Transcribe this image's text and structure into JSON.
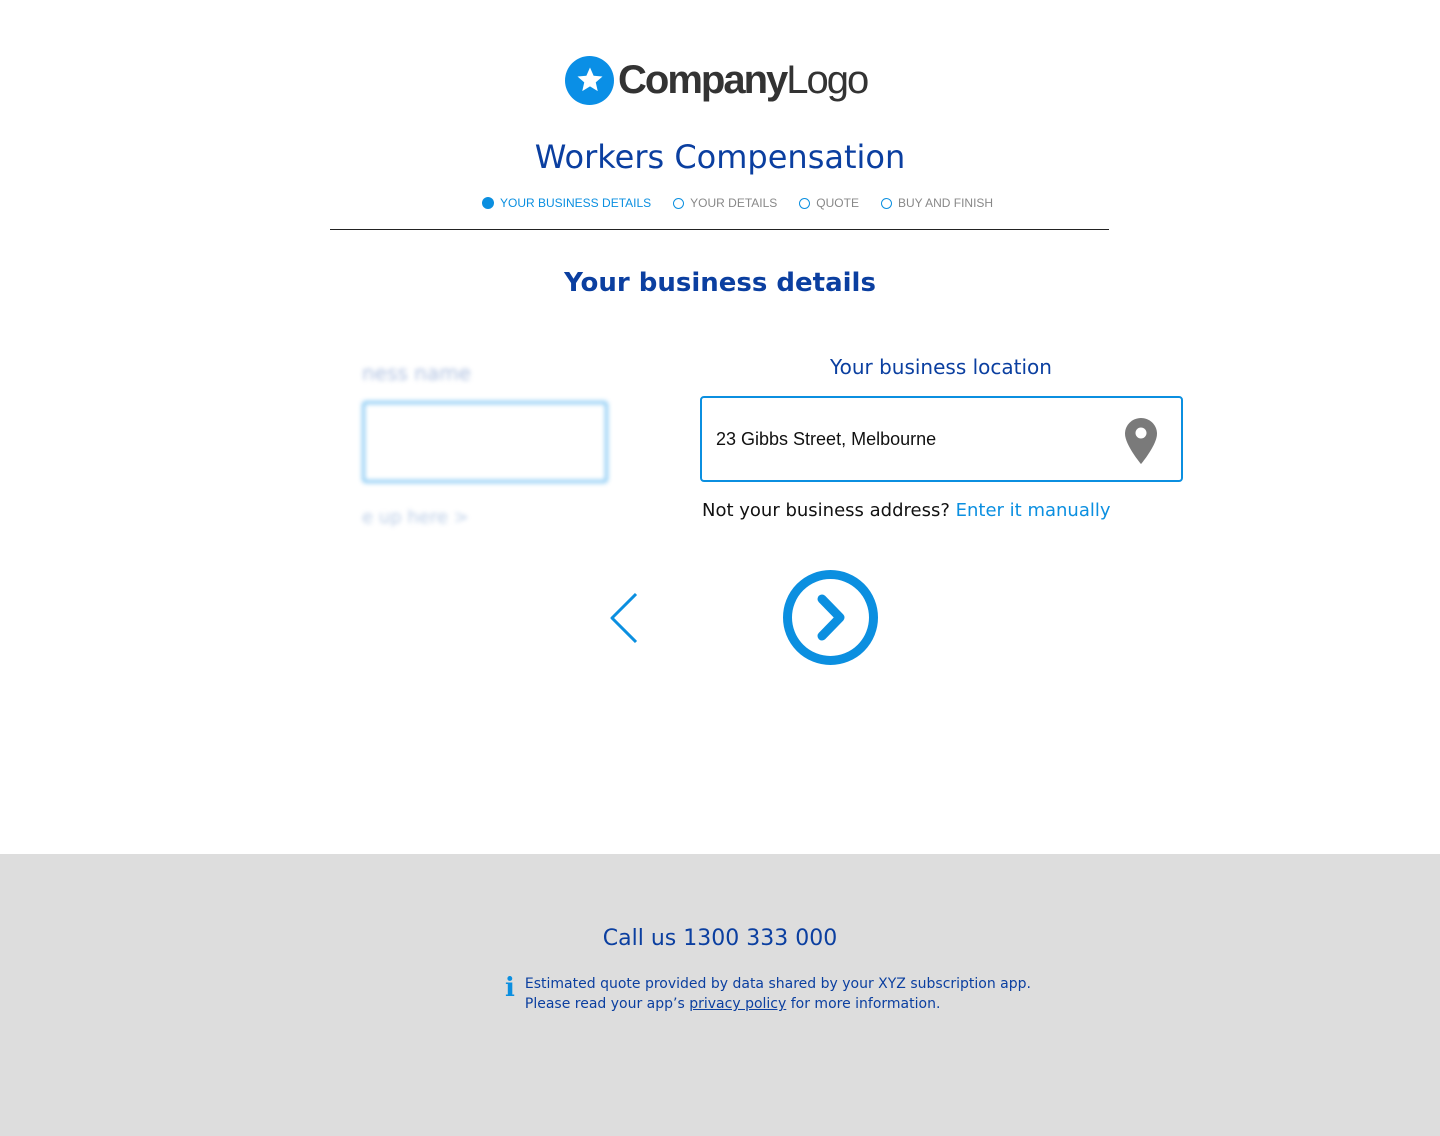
{
  "logo": {
    "text_bold": "Company",
    "text_regular": "Logo",
    "icon": "star-icon"
  },
  "title": "Workers Compensation",
  "steps": [
    {
      "label": "YOUR BUSINESS DETAILS",
      "active": true
    },
    {
      "label": "YOUR DETAILS",
      "active": false
    },
    {
      "label": "QUOTE",
      "active": false
    },
    {
      "label": "BUY AND FINISH",
      "active": false
    }
  ],
  "section_title": "Your business details",
  "blurred_panel": {
    "label": "ness name",
    "link": "e up here >"
  },
  "location": {
    "label": "Your business location",
    "value": "23 Gibbs Street, Melbourne",
    "icon": "map-pin-icon"
  },
  "manual": {
    "prompt": "Not your business address?",
    "link": "Enter it manually"
  },
  "nav": {
    "back_icon": "chevron-left-icon",
    "next_icon": "chevron-right-circle-icon"
  },
  "footer": {
    "call": "Call us 1300 333 000",
    "info_line1": "Estimated quote provided by data shared by your XYZ subscription app.",
    "info_line2_pre": "Please read your app’s",
    "info_link": "privacy policy",
    "info_line2_post": "for more information."
  },
  "colors": {
    "accent": "#0b8fe0",
    "navy": "#0b3fa0",
    "footer_bg": "#dddddd"
  }
}
